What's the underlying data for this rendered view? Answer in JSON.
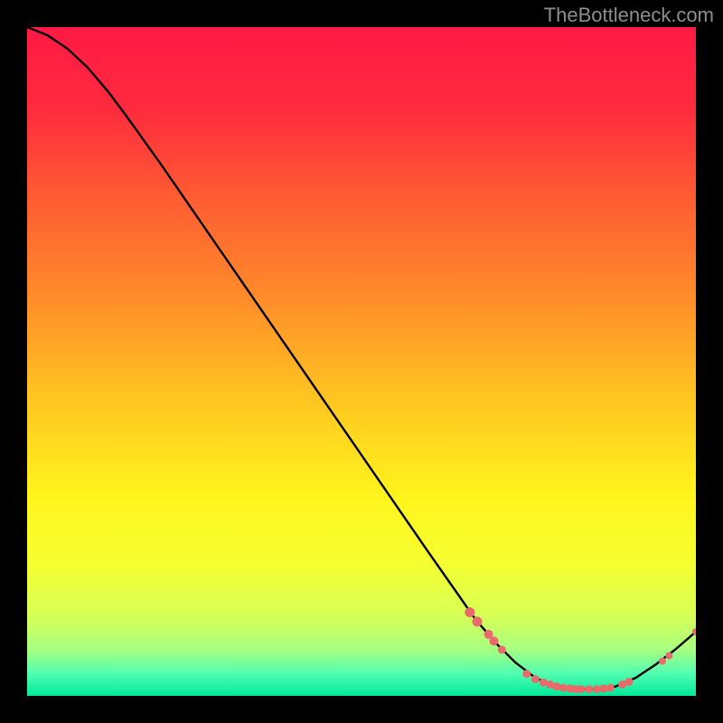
{
  "attribution": "TheBottleneck.com",
  "chart_data": {
    "type": "line",
    "title": "",
    "xlabel": "",
    "ylabel": "",
    "xlim": [
      0,
      100
    ],
    "ylim": [
      0,
      100
    ],
    "background_gradient_stops": [
      {
        "offset": 0.0,
        "color": "#ff1a44"
      },
      {
        "offset": 0.12,
        "color": "#ff2a3f"
      },
      {
        "offset": 0.25,
        "color": "#ff5a33"
      },
      {
        "offset": 0.4,
        "color": "#ff8a2a"
      },
      {
        "offset": 0.55,
        "color": "#ffc321"
      },
      {
        "offset": 0.7,
        "color": "#fff41c"
      },
      {
        "offset": 0.8,
        "color": "#f6ff30"
      },
      {
        "offset": 0.88,
        "color": "#d6ff55"
      },
      {
        "offset": 0.93,
        "color": "#a8ff80"
      },
      {
        "offset": 0.965,
        "color": "#55ffb0"
      },
      {
        "offset": 1.0,
        "color": "#00e89a"
      }
    ],
    "curve": [
      {
        "x": 0.0,
        "y": 100.0
      },
      {
        "x": 3.0,
        "y": 98.8
      },
      {
        "x": 6.0,
        "y": 96.8
      },
      {
        "x": 9.0,
        "y": 94.0
      },
      {
        "x": 12.0,
        "y": 90.5
      },
      {
        "x": 15.0,
        "y": 86.5
      },
      {
        "x": 20.0,
        "y": 79.5
      },
      {
        "x": 30.0,
        "y": 65.0
      },
      {
        "x": 40.0,
        "y": 50.5
      },
      {
        "x": 50.0,
        "y": 36.0
      },
      {
        "x": 60.0,
        "y": 21.5
      },
      {
        "x": 67.0,
        "y": 11.5
      },
      {
        "x": 70.0,
        "y": 8.0
      },
      {
        "x": 73.0,
        "y": 5.0
      },
      {
        "x": 76.0,
        "y": 2.7
      },
      {
        "x": 79.0,
        "y": 1.4
      },
      {
        "x": 82.0,
        "y": 1.0
      },
      {
        "x": 85.0,
        "y": 1.0
      },
      {
        "x": 88.0,
        "y": 1.4
      },
      {
        "x": 91.0,
        "y": 2.7
      },
      {
        "x": 94.0,
        "y": 4.7
      },
      {
        "x": 97.0,
        "y": 7.0
      },
      {
        "x": 100.0,
        "y": 9.6
      }
    ],
    "markers": [
      {
        "x": 66.2,
        "y": 12.5,
        "r": 5.5
      },
      {
        "x": 67.3,
        "y": 11.1,
        "r": 5.5
      },
      {
        "x": 69.0,
        "y": 9.2,
        "r": 5.0
      },
      {
        "x": 69.8,
        "y": 8.2,
        "r": 5.0
      },
      {
        "x": 71.0,
        "y": 6.9,
        "r": 4.5
      },
      {
        "x": 74.7,
        "y": 3.3,
        "r": 4.5
      },
      {
        "x": 76.0,
        "y": 2.5,
        "r": 4.5
      },
      {
        "x": 77.2,
        "y": 2.0,
        "r": 4.5
      },
      {
        "x": 78.2,
        "y": 1.7,
        "r": 4.5
      },
      {
        "x": 79.2,
        "y": 1.4,
        "r": 4.5
      },
      {
        "x": 80.2,
        "y": 1.2,
        "r": 4.5
      },
      {
        "x": 81.2,
        "y": 1.1,
        "r": 4.5
      },
      {
        "x": 82.0,
        "y": 1.0,
        "r": 4.5
      },
      {
        "x": 82.8,
        "y": 1.0,
        "r": 4.5
      },
      {
        "x": 84.0,
        "y": 1.0,
        "r": 4.5
      },
      {
        "x": 85.2,
        "y": 1.0,
        "r": 4.5
      },
      {
        "x": 86.2,
        "y": 1.1,
        "r": 4.5
      },
      {
        "x": 87.2,
        "y": 1.2,
        "r": 4.5
      },
      {
        "x": 89.0,
        "y": 1.7,
        "r": 4.5
      },
      {
        "x": 90.0,
        "y": 2.1,
        "r": 4.5
      },
      {
        "x": 95.0,
        "y": 5.2,
        "r": 4.0
      },
      {
        "x": 96.0,
        "y": 6.0,
        "r": 4.0
      },
      {
        "x": 100.0,
        "y": 9.6,
        "r": 4.0
      }
    ],
    "marker_color": "#e86a6a"
  }
}
